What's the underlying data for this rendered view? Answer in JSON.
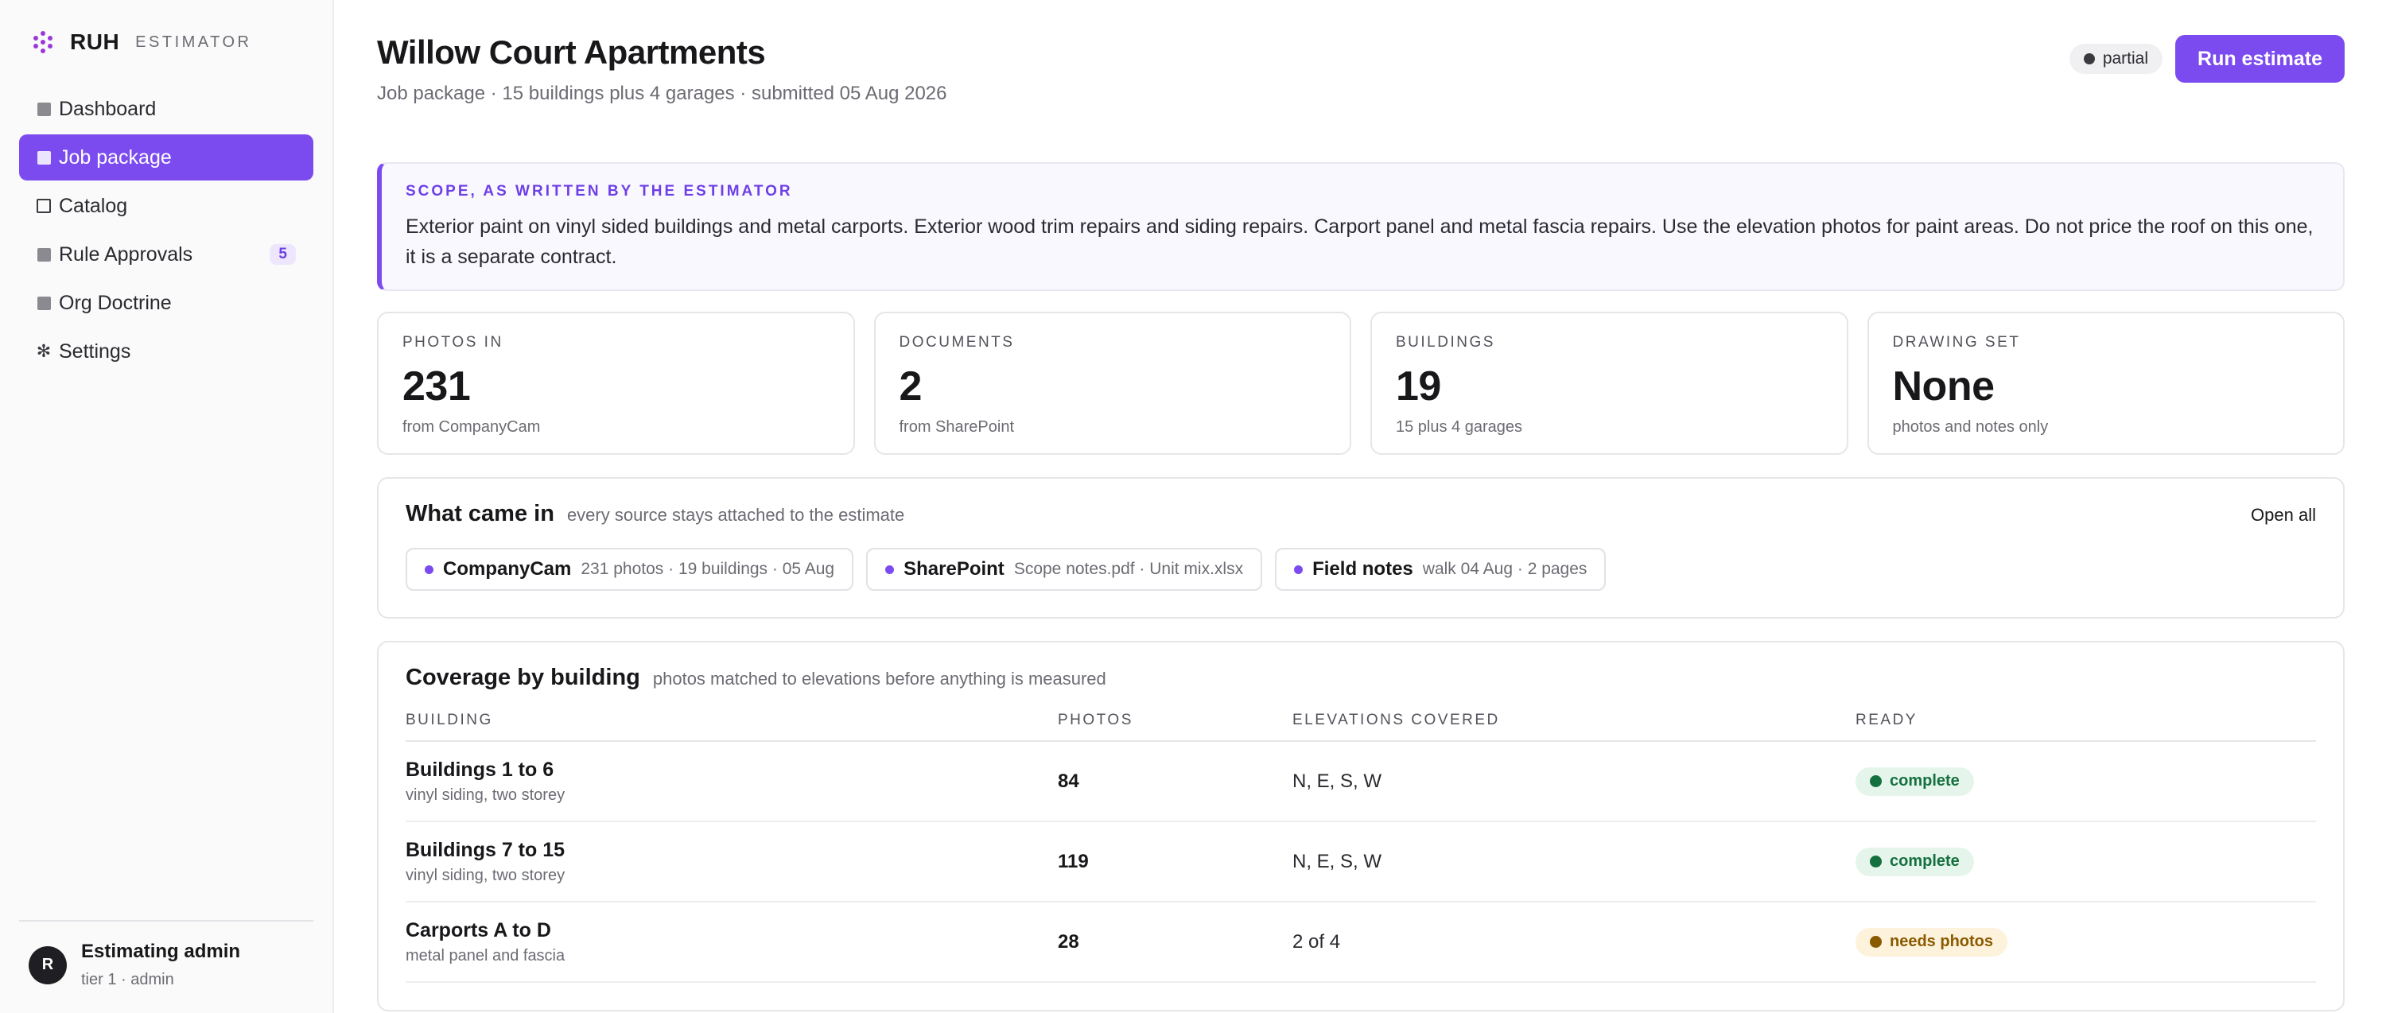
{
  "brand": {
    "name": "RUH",
    "subtitle": "ESTIMATOR",
    "accent": "#9b38d8"
  },
  "sidebar": {
    "items": [
      {
        "label": "Dashboard",
        "icon": "square-filled-icon",
        "active": false
      },
      {
        "label": "Job package",
        "icon": "square-filled-icon",
        "active": true
      },
      {
        "label": "Catalog",
        "icon": "square-outline-icon",
        "active": false
      },
      {
        "label": "Rule Approvals",
        "icon": "square-filled-icon",
        "active": false,
        "badge": "5"
      },
      {
        "label": "Org Doctrine",
        "icon": "square-filled-icon",
        "active": false
      },
      {
        "label": "Settings",
        "icon": "asterisk-icon",
        "glyph": "✻",
        "active": false
      }
    ],
    "user": {
      "initial": "R",
      "name": "Estimating admin",
      "role": "tier 1 · admin"
    }
  },
  "header": {
    "title": "Willow Court Apartments",
    "subtitle": "Job package · 15 buildings plus 4 garages · submitted 05 Aug 2026",
    "status": {
      "label": "partial",
      "color": "#3a3a40"
    },
    "run_label": "Run estimate"
  },
  "scope": {
    "eyebrow": "SCOPE, AS WRITTEN BY THE ESTIMATOR",
    "text": "Exterior paint on vinyl sided buildings and metal carports. Exterior wood trim repairs and siding repairs. Carport panel and metal fascia repairs. Use the elevation photos for paint areas. Do not price the roof on this one, it is a separate contract."
  },
  "stats": [
    {
      "label": "PHOTOS IN",
      "value": "231",
      "note": "from CompanyCam"
    },
    {
      "label": "DOCUMENTS",
      "value": "2",
      "note": "from SharePoint"
    },
    {
      "label": "BUILDINGS",
      "value": "19",
      "note": "15 plus 4 garages"
    },
    {
      "label": "DRAWING SET",
      "value": "None",
      "note": "photos and notes only"
    }
  ],
  "sources": {
    "title": "What came in",
    "subtitle": "every source stays attached to the estimate",
    "open_all": "Open all",
    "items": [
      {
        "name": "CompanyCam",
        "meta": "231 photos · 19 buildings · 05 Aug"
      },
      {
        "name": "SharePoint",
        "meta": "Scope notes.pdf · Unit mix.xlsx"
      },
      {
        "name": "Field notes",
        "meta": "walk 04 Aug · 2 pages"
      }
    ]
  },
  "coverage": {
    "title": "Coverage by building",
    "subtitle": "photos matched to elevations before anything is measured",
    "columns": [
      "BUILDING",
      "PHOTOS",
      "ELEVATIONS COVERED",
      "READY"
    ],
    "rows": [
      {
        "building": "Buildings 1 to 6",
        "detail": "vinyl siding, two storey",
        "photos": "84",
        "elevations": "N, E, S, W",
        "ready": "complete",
        "ready_bg": "#e6f5ec",
        "ready_fg": "#15703f"
      },
      {
        "building": "Buildings 7 to 15",
        "detail": "vinyl siding, two storey",
        "photos": "119",
        "elevations": "N, E, S, W",
        "ready": "complete",
        "ready_bg": "#e6f5ec",
        "ready_fg": "#15703f"
      },
      {
        "building": "Carports A to D",
        "detail": "metal panel and fascia",
        "photos": "28",
        "elevations": "2 of 4",
        "ready": "needs photos",
        "ready_bg": "#fdf3dc",
        "ready_fg": "#8a5a00"
      }
    ]
  }
}
